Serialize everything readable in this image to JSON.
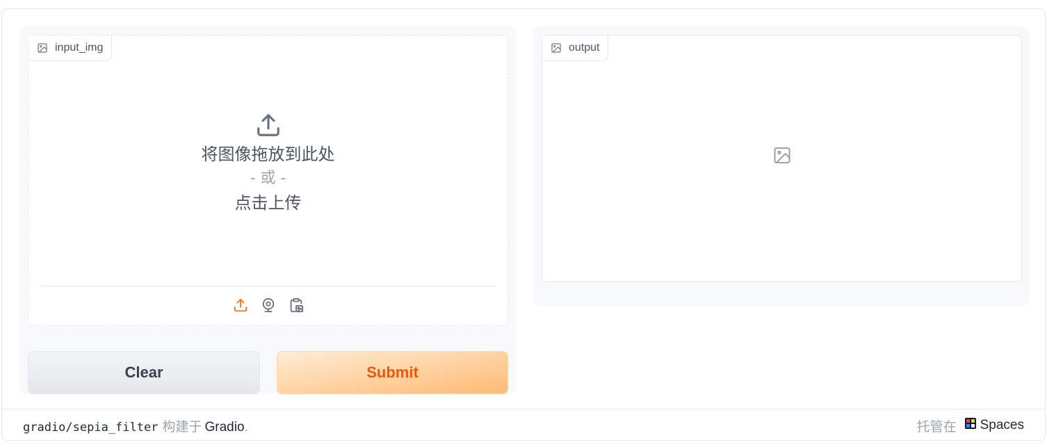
{
  "input": {
    "label": "input_img",
    "label_icon": "image-icon",
    "drop_text": "将图像拖放到此处",
    "or_text": "- 或 -",
    "click_text": "点击上传",
    "sources": [
      {
        "icon": "upload-icon",
        "color": "#f97316"
      },
      {
        "icon": "webcam-icon",
        "color": "#6b7280"
      },
      {
        "icon": "clipboard-icon",
        "color": "#6b7280"
      }
    ]
  },
  "output": {
    "label": "output",
    "label_icon": "image-icon",
    "placeholder_icon": "image-icon"
  },
  "buttons": {
    "clear": "Clear",
    "submit": "Submit"
  },
  "footer": {
    "repo": "gradio/sepia_filter",
    "built_with": "构建于",
    "framework": "Gradio",
    "dot": ".",
    "hosted_on": "托管在",
    "spaces": "Spaces"
  },
  "colors": {
    "accent": "#ea580c",
    "submit_gradient_start": "#ffedd5",
    "submit_gradient_end": "#fdba74"
  }
}
